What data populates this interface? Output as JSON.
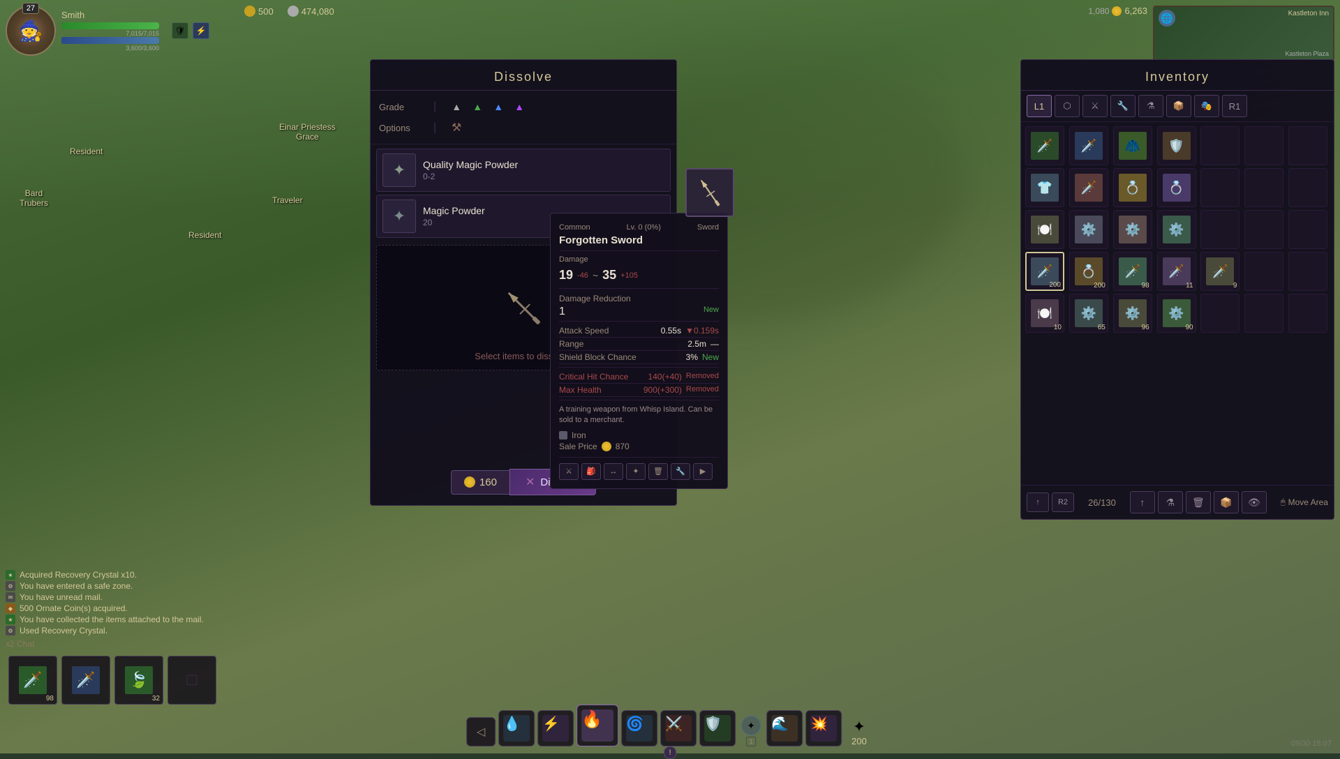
{
  "game": {
    "bg_gradient": "linear-gradient(160deg, #4a6a3a, #3a5a2a)",
    "timestamp": "09/30 16:07"
  },
  "hud": {
    "player": {
      "level": "27",
      "name": "Smith",
      "health_current": "7,015",
      "health_max": "7,015",
      "stamina_current": "3,600",
      "stamina_max": "3,600",
      "health_pct": "100",
      "stamina_pct": "100"
    },
    "currency": {
      "ornate": "500",
      "silver": "474,080"
    },
    "top_right": {
      "label1": "1,080",
      "label2": "6,263"
    },
    "bottom_counter": "200"
  },
  "chat": {
    "entries": [
      {
        "icon_type": "green",
        "text": "Acquired Recovery Crystal x10."
      },
      {
        "icon_type": "gray",
        "text": "You have entered a safe zone."
      },
      {
        "icon_type": "gray",
        "text": "You have unread mail."
      },
      {
        "icon_type": "orange",
        "text": "500 Ornate Coin(s) acquired."
      },
      {
        "icon_type": "green",
        "text": "You have collected the items attached to the mail."
      },
      {
        "icon_type": "gray",
        "text": "Used Recovery Crystal."
      }
    ],
    "chat_tab": "x2 Chat"
  },
  "dissolve": {
    "title": "Dissolve",
    "grade_label": "Grade",
    "options_label": "Options",
    "select_prompt": "Select items to dissolve.",
    "items": [
      {
        "name": "Quality Magic Powder",
        "count": "0-2",
        "icon": "✦"
      },
      {
        "name": "Magic Powder",
        "count": "20",
        "icon": "✦"
      }
    ],
    "cost": "160",
    "button_label": "Dissolve",
    "x_icon": "✕"
  },
  "item_detail": {
    "quality": "Common",
    "level": "Lv. 0 (0%)",
    "type": "Sword",
    "name": "Forgotten Sword",
    "damage_label": "Damage",
    "damage_base": "19",
    "damage_old_suffix": "-46",
    "damage_arrow": "~",
    "damage_new": "35",
    "damage_new_suffix": "+105",
    "dmg_reduction_label": "Damage Reduction",
    "dmg_reduction_val": "1",
    "dmg_reduction_new": "New",
    "attack_speed_label": "Attack Speed",
    "attack_speed_val": "0.55s",
    "attack_speed_diff": "▼0.159s",
    "range_label": "Range",
    "range_val": "2.5m",
    "range_diff": "—",
    "shield_block_label": "Shield Block Chance",
    "shield_block_val": "3%",
    "shield_block_new": "New",
    "crit_hit_label": "Critical Hit Chance",
    "crit_hit_val": "140(+40)",
    "crit_hit_status": "Removed",
    "max_health_label": "Max Health",
    "max_health_val": "900(+300)",
    "max_health_status": "Removed",
    "description": "A training weapon from Whisp Island. Can be sold to a merchant.",
    "material_label": "Iron",
    "sale_label": "Sale Price",
    "sale_value": "870"
  },
  "inventory": {
    "title": "Inventory",
    "count": "26/130",
    "tabs": [
      "L1",
      "⬡",
      "⚔",
      "🔧",
      "⚗",
      "📦",
      "🎭",
      "R1"
    ],
    "move_area": "Move Area",
    "slots": [
      {
        "has_item": true,
        "icon": "🗡️",
        "count": "",
        "color": "#3a6a3a"
      },
      {
        "has_item": true,
        "icon": "🗡️",
        "count": "",
        "color": "#3a4a6a"
      },
      {
        "has_item": true,
        "icon": "🍃",
        "count": "",
        "color": "#3a5a3a"
      },
      {
        "has_item": true,
        "icon": "🛡️",
        "count": "",
        "color": "#4a3a3a"
      },
      {
        "has_item": false,
        "icon": "",
        "count": "",
        "color": ""
      },
      {
        "has_item": false,
        "icon": "",
        "count": "",
        "color": ""
      },
      {
        "has_item": false,
        "icon": "",
        "count": "",
        "color": ""
      },
      {
        "has_item": true,
        "icon": "👕",
        "count": "",
        "color": "#3a4a5a"
      },
      {
        "has_item": true,
        "icon": "🗡️",
        "count": "",
        "color": "#5a3a3a"
      },
      {
        "has_item": true,
        "icon": "💍",
        "count": "",
        "color": "#6a5a2a"
      },
      {
        "has_item": true,
        "icon": "💍",
        "count": "",
        "color": "#4a3a6a"
      },
      {
        "has_item": false,
        "icon": "",
        "count": "",
        "color": ""
      },
      {
        "has_item": false,
        "icon": "",
        "count": "",
        "color": ""
      },
      {
        "has_item": false,
        "icon": "",
        "count": "",
        "color": ""
      },
      {
        "has_item": true,
        "icon": "🥣",
        "count": "",
        "color": "#4a4a3a"
      },
      {
        "has_item": true,
        "icon": "⚙️",
        "count": "",
        "color": "#4a4a5a"
      },
      {
        "has_item": true,
        "icon": "⚙️",
        "count": "",
        "color": "#5a4a4a"
      },
      {
        "has_item": true,
        "icon": "⚙️",
        "count": "",
        "color": "#3a5a4a"
      },
      {
        "has_item": false,
        "icon": "",
        "count": "",
        "color": ""
      },
      {
        "has_item": false,
        "icon": "",
        "count": "",
        "color": ""
      },
      {
        "has_item": false,
        "icon": "",
        "count": "",
        "color": ""
      },
      {
        "has_item": true,
        "icon": "🗡️",
        "count": "200",
        "color": "#3a4a5a",
        "selected": true
      },
      {
        "has_item": true,
        "icon": "💍",
        "count": "200",
        "color": "#5a4a2a"
      },
      {
        "has_item": true,
        "icon": "🗡️",
        "count": "98",
        "color": "#3a5a4a"
      },
      {
        "has_item": true,
        "icon": "🗡️",
        "count": "11",
        "color": "#4a3a5a"
      },
      {
        "has_item": true,
        "icon": "🗡️",
        "count": "9",
        "color": "#4a4a3a"
      },
      {
        "has_item": false,
        "icon": "",
        "count": "",
        "color": ""
      },
      {
        "has_item": false,
        "icon": "",
        "count": "",
        "color": ""
      },
      {
        "has_item": true,
        "icon": "🍽️",
        "count": "10",
        "color": "#4a3a4a"
      },
      {
        "has_item": true,
        "icon": "⚙️",
        "count": "65",
        "color": "#3a4a4a"
      },
      {
        "has_item": true,
        "icon": "⚙️",
        "count": "96",
        "color": "#4a4a3a"
      },
      {
        "has_item": true,
        "icon": "⚙️",
        "count": "90",
        "color": "#3a5a3a"
      },
      {
        "has_item": false,
        "icon": "",
        "count": "",
        "color": ""
      },
      {
        "has_item": false,
        "icon": "",
        "count": "",
        "color": ""
      },
      {
        "has_item": false,
        "icon": "",
        "count": "",
        "color": ""
      }
    ]
  },
  "npc": {
    "label1": "Einar Priestess\nGrace",
    "label2": "Resident",
    "label3": "Bard\nTrubers",
    "label4": "Traveler",
    "label5": "Resident"
  },
  "quickbar": {
    "slots": [
      {
        "icon": "🗡️",
        "count": "98",
        "color": "#3a5a3a"
      },
      {
        "icon": "🗡️",
        "count": "",
        "color": "#3a4a5a"
      },
      {
        "icon": "🍃",
        "count": "32",
        "color": "#3a5a2a"
      },
      {
        "icon": "",
        "count": "",
        "color": ""
      }
    ]
  }
}
